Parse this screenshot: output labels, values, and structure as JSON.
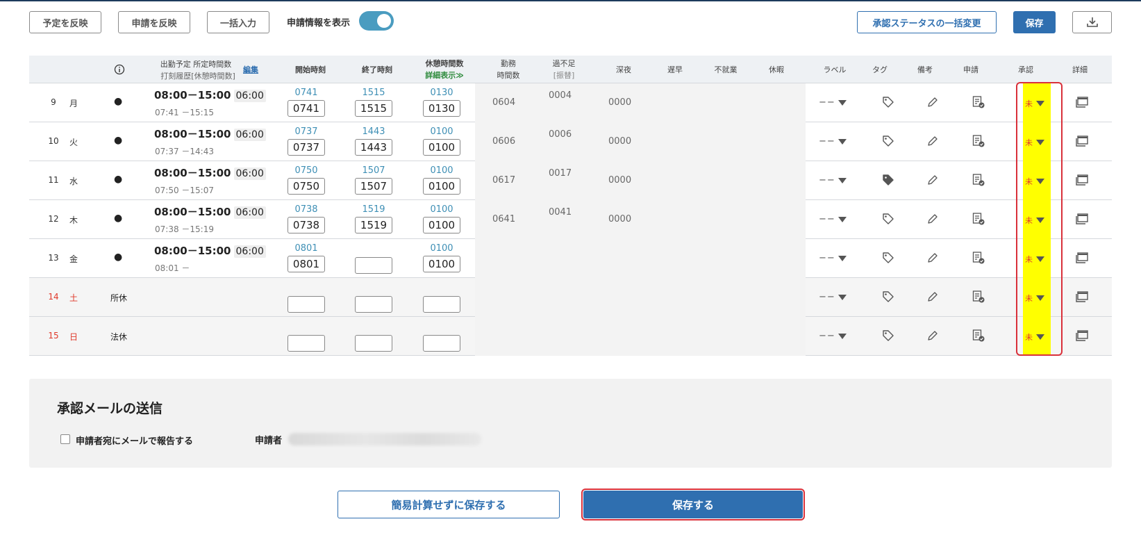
{
  "toolbar": {
    "reflect_plan": "予定を反映",
    "reflect_request": "申請を反映",
    "bulk_input": "一括入力",
    "show_request_info": "申請情報を表示",
    "bulk_status_change": "承認ステータスの一括変更",
    "save": "保存"
  },
  "header": {
    "planned": "出勤予定",
    "scheduled_hours": "所定時間数",
    "edit": "編集",
    "punch_history": "打刻履歴",
    "break_hours_bracket": "[休憩時間数]",
    "start": "開始時刻",
    "end": "終了時刻",
    "break": "休憩時間数",
    "detail_show": "詳細表示≫",
    "work1": "勤務",
    "work2": "時間数",
    "over1": "過不足",
    "over2": "[振替]",
    "night": "深夜",
    "late": "遅早",
    "absent": "不就業",
    "leave": "休暇",
    "label": "ラベル",
    "tag": "タグ",
    "note": "備考",
    "request": "申請",
    "approval": "承認",
    "detail": "詳細"
  },
  "rows": [
    {
      "day": "9",
      "wd": "月",
      "mark": "●",
      "plan": "08:00－15:00",
      "sched": "06:00",
      "hist": "07:41 －15:15",
      "s_top": "0741",
      "s_in": "0741",
      "e_top": "1515",
      "e_in": "1515",
      "b_top": "0130",
      "b_in": "0130",
      "work": "0604",
      "over": "0004",
      "night": "0000",
      "label": "−−",
      "approval": "未"
    },
    {
      "day": "10",
      "wd": "火",
      "mark": "●",
      "plan": "08:00－15:00",
      "sched": "06:00",
      "hist": "07:37 －14:43",
      "s_top": "0737",
      "s_in": "0737",
      "e_top": "1443",
      "e_in": "1443",
      "b_top": "0100",
      "b_in": "0100",
      "work": "0606",
      "over": "0006",
      "night": "0000",
      "label": "−−",
      "approval": "未"
    },
    {
      "day": "11",
      "wd": "水",
      "mark": "●",
      "plan": "08:00－15:00",
      "sched": "06:00",
      "hist": "07:50 －15:07",
      "s_top": "0750",
      "s_in": "0750",
      "e_top": "1507",
      "e_in": "1507",
      "b_top": "0100",
      "b_in": "0100",
      "work": "0617",
      "over": "0017",
      "night": "0000",
      "label": "−−",
      "approval": "未"
    },
    {
      "day": "12",
      "wd": "木",
      "mark": "●",
      "plan": "08:00－15:00",
      "sched": "06:00",
      "hist": "07:38 －15:19",
      "s_top": "0738",
      "s_in": "0738",
      "e_top": "1519",
      "e_in": "1519",
      "b_top": "0100",
      "b_in": "0100",
      "work": "0641",
      "over": "0041",
      "night": "0000",
      "label": "−−",
      "approval": "未"
    },
    {
      "day": "13",
      "wd": "金",
      "mark": "●",
      "plan": "08:00－15:00",
      "sched": "06:00",
      "hist": "08:01 －",
      "s_top": "0801",
      "s_in": "0801",
      "e_top": "",
      "e_in": "",
      "b_top": "0100",
      "b_in": "0100",
      "work": "",
      "over": "",
      "night": "",
      "label": "−−",
      "approval": "未"
    },
    {
      "day": "14",
      "wd": "土",
      "mark": "所休",
      "plan": "",
      "sched": "",
      "hist": "",
      "s_top": "",
      "s_in": "",
      "e_top": "",
      "e_in": "",
      "b_top": "",
      "b_in": "",
      "work": "",
      "over": "",
      "night": "",
      "label": "−−",
      "approval": "未"
    },
    {
      "day": "15",
      "wd": "日",
      "mark": "法休",
      "plan": "",
      "sched": "",
      "hist": "",
      "s_top": "",
      "s_in": "",
      "e_top": "",
      "e_in": "",
      "b_top": "",
      "b_in": "",
      "work": "",
      "over": "",
      "night": "",
      "label": "−−",
      "approval": "未"
    }
  ],
  "mail": {
    "title": "承認メールの送信",
    "checkbox_label": "申請者宛にメールで報告する",
    "requester_label": "申請者"
  },
  "bottom": {
    "save_no_calc": "簡易計算せずに保存する",
    "save": "保存する"
  },
  "colors": {
    "primary": "#2f6fb0",
    "highlight": "#ffff00",
    "frame": "#d9303a",
    "weekend_text": "#e0392b"
  },
  "icons": [
    "info-icon",
    "download-icon",
    "tag-icon",
    "pencil-icon",
    "request-doc-icon",
    "detail-window-icon"
  ]
}
